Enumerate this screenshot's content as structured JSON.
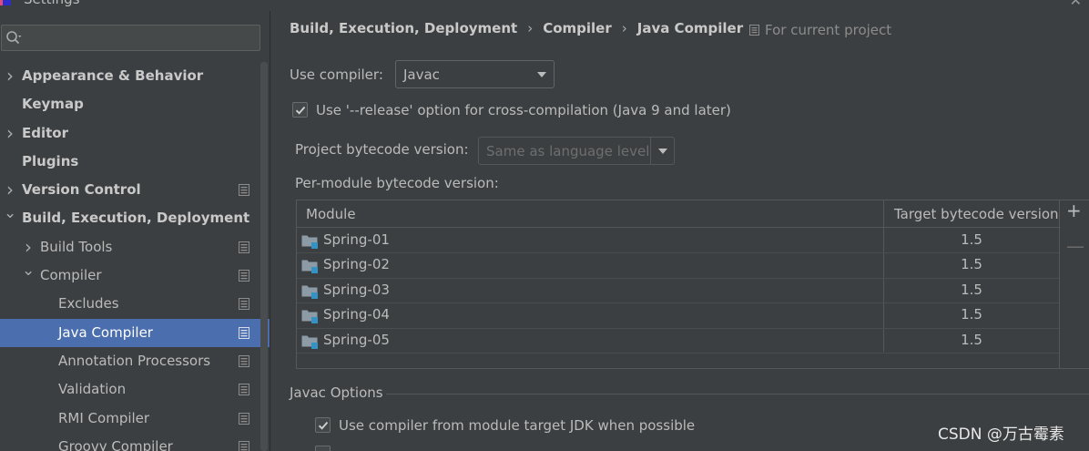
{
  "window": {
    "title": "Settings"
  },
  "search": {
    "placeholder": ""
  },
  "tree": [
    {
      "label": "Appearance & Behavior",
      "level": 0,
      "bold": true,
      "chevron": "right",
      "page_icon": false
    },
    {
      "label": "Keymap",
      "level": 0,
      "bold": true,
      "chevron": "",
      "page_icon": false
    },
    {
      "label": "Editor",
      "level": 0,
      "bold": true,
      "chevron": "right",
      "page_icon": false
    },
    {
      "label": "Plugins",
      "level": 0,
      "bold": true,
      "chevron": "",
      "page_icon": false
    },
    {
      "label": "Version Control",
      "level": 0,
      "bold": true,
      "chevron": "right",
      "page_icon": true
    },
    {
      "label": "Build, Execution, Deployment",
      "level": 0,
      "bold": true,
      "chevron": "down",
      "page_icon": false
    },
    {
      "label": "Build Tools",
      "level": 1,
      "bold": false,
      "chevron": "right",
      "page_icon": true
    },
    {
      "label": "Compiler",
      "level": 1,
      "bold": false,
      "chevron": "down",
      "page_icon": true
    },
    {
      "label": "Excludes",
      "level": 2,
      "bold": false,
      "chevron": "",
      "page_icon": true
    },
    {
      "label": "Java Compiler",
      "level": 2,
      "bold": false,
      "chevron": "",
      "page_icon": true,
      "selected": true
    },
    {
      "label": "Annotation Processors",
      "level": 2,
      "bold": false,
      "chevron": "",
      "page_icon": true
    },
    {
      "label": "Validation",
      "level": 2,
      "bold": false,
      "chevron": "",
      "page_icon": true
    },
    {
      "label": "RMI Compiler",
      "level": 2,
      "bold": false,
      "chevron": "",
      "page_icon": true
    },
    {
      "label": "Groovy Compiler",
      "level": 2,
      "bold": false,
      "chevron": "",
      "page_icon": true
    }
  ],
  "breadcrumb": {
    "part1": "Build, Execution, Deployment",
    "part2": "Compiler",
    "part3": "Java Compiler",
    "separator": "›"
  },
  "scope": {
    "label": "For current project"
  },
  "compiler": {
    "label": "Use compiler:",
    "value": "Javac"
  },
  "release_option": {
    "label": "Use '--release' option for cross-compilation (Java 9 and later)",
    "checked": true
  },
  "bytecode": {
    "label": "Project bytecode version:",
    "placeholder": "Same as language level"
  },
  "per_module": {
    "label": "Per-module bytecode version:",
    "columns": {
      "module": "Module",
      "target": "Target bytecode version"
    },
    "rows": [
      {
        "module": "Spring-01",
        "version": "1.5"
      },
      {
        "module": "Spring-02",
        "version": "1.5"
      },
      {
        "module": "Spring-03",
        "version": "1.5"
      },
      {
        "module": "Spring-04",
        "version": "1.5"
      },
      {
        "module": "Spring-05",
        "version": "1.5"
      }
    ],
    "add_label": "+",
    "remove_label": "—"
  },
  "javac_options": {
    "title": "Javac Options",
    "use_module_jdk": {
      "label": "Use compiler from module target JDK when possible",
      "checked": true
    }
  },
  "watermark": "CSDN @万古霉素",
  "colors": {
    "selection": "#4b6eaf",
    "panel": "#3c3f41",
    "accent_blue": "#3592c4"
  }
}
